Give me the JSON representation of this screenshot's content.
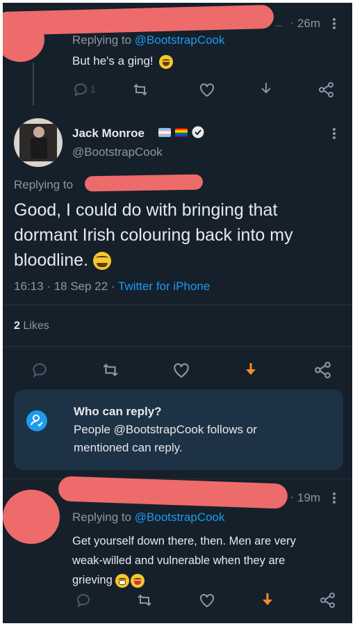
{
  "reply_top": {
    "timestamp": "26m",
    "replying_prefix": "Replying to",
    "replying_handle": "@BootstrapCook",
    "text": "But he's a ging!",
    "reply_count": "1"
  },
  "main_tweet": {
    "author_name": "Jack Monroe",
    "author_handle": "@BootstrapCook",
    "replying_prefix": "Replying to",
    "text_line1": "Good, I could do with bringing that",
    "text_line2": "dormant Irish colouring back into my",
    "text_line3": "bloodline.",
    "time": "16:13",
    "date": "18 Sep 22",
    "source": "Twitter for iPhone",
    "likes_count": "2",
    "likes_label": "Likes"
  },
  "who_can_reply": {
    "title": "Who can reply?",
    "line1": "People @BootstrapCook follows or",
    "line2": "mentioned can reply."
  },
  "reply_bottom": {
    "timestamp": "19m",
    "replying_prefix": "Replying to",
    "replying_handle": "@BootstrapCook",
    "text_line1": "Get yourself down there, then. Men are very",
    "text_line2": "weak-willed and vulnerable when they are",
    "text_line3": "grieving"
  },
  "separator": "·",
  "ellipsis": "...",
  "colors": {
    "background": "#15202b",
    "accent": "#1d9bf0",
    "highlight_orange": "#f98c25",
    "redaction": "#ee6b6b"
  },
  "icons": [
    "reply-icon",
    "retweet-icon",
    "like-icon",
    "share-icon",
    "more-icon",
    "verified-badge-icon",
    "flag-icon",
    "download-arrow-icon",
    "tie-emoji",
    "grimace-emoji",
    "yum-emoji",
    "laughing-emoji"
  ]
}
